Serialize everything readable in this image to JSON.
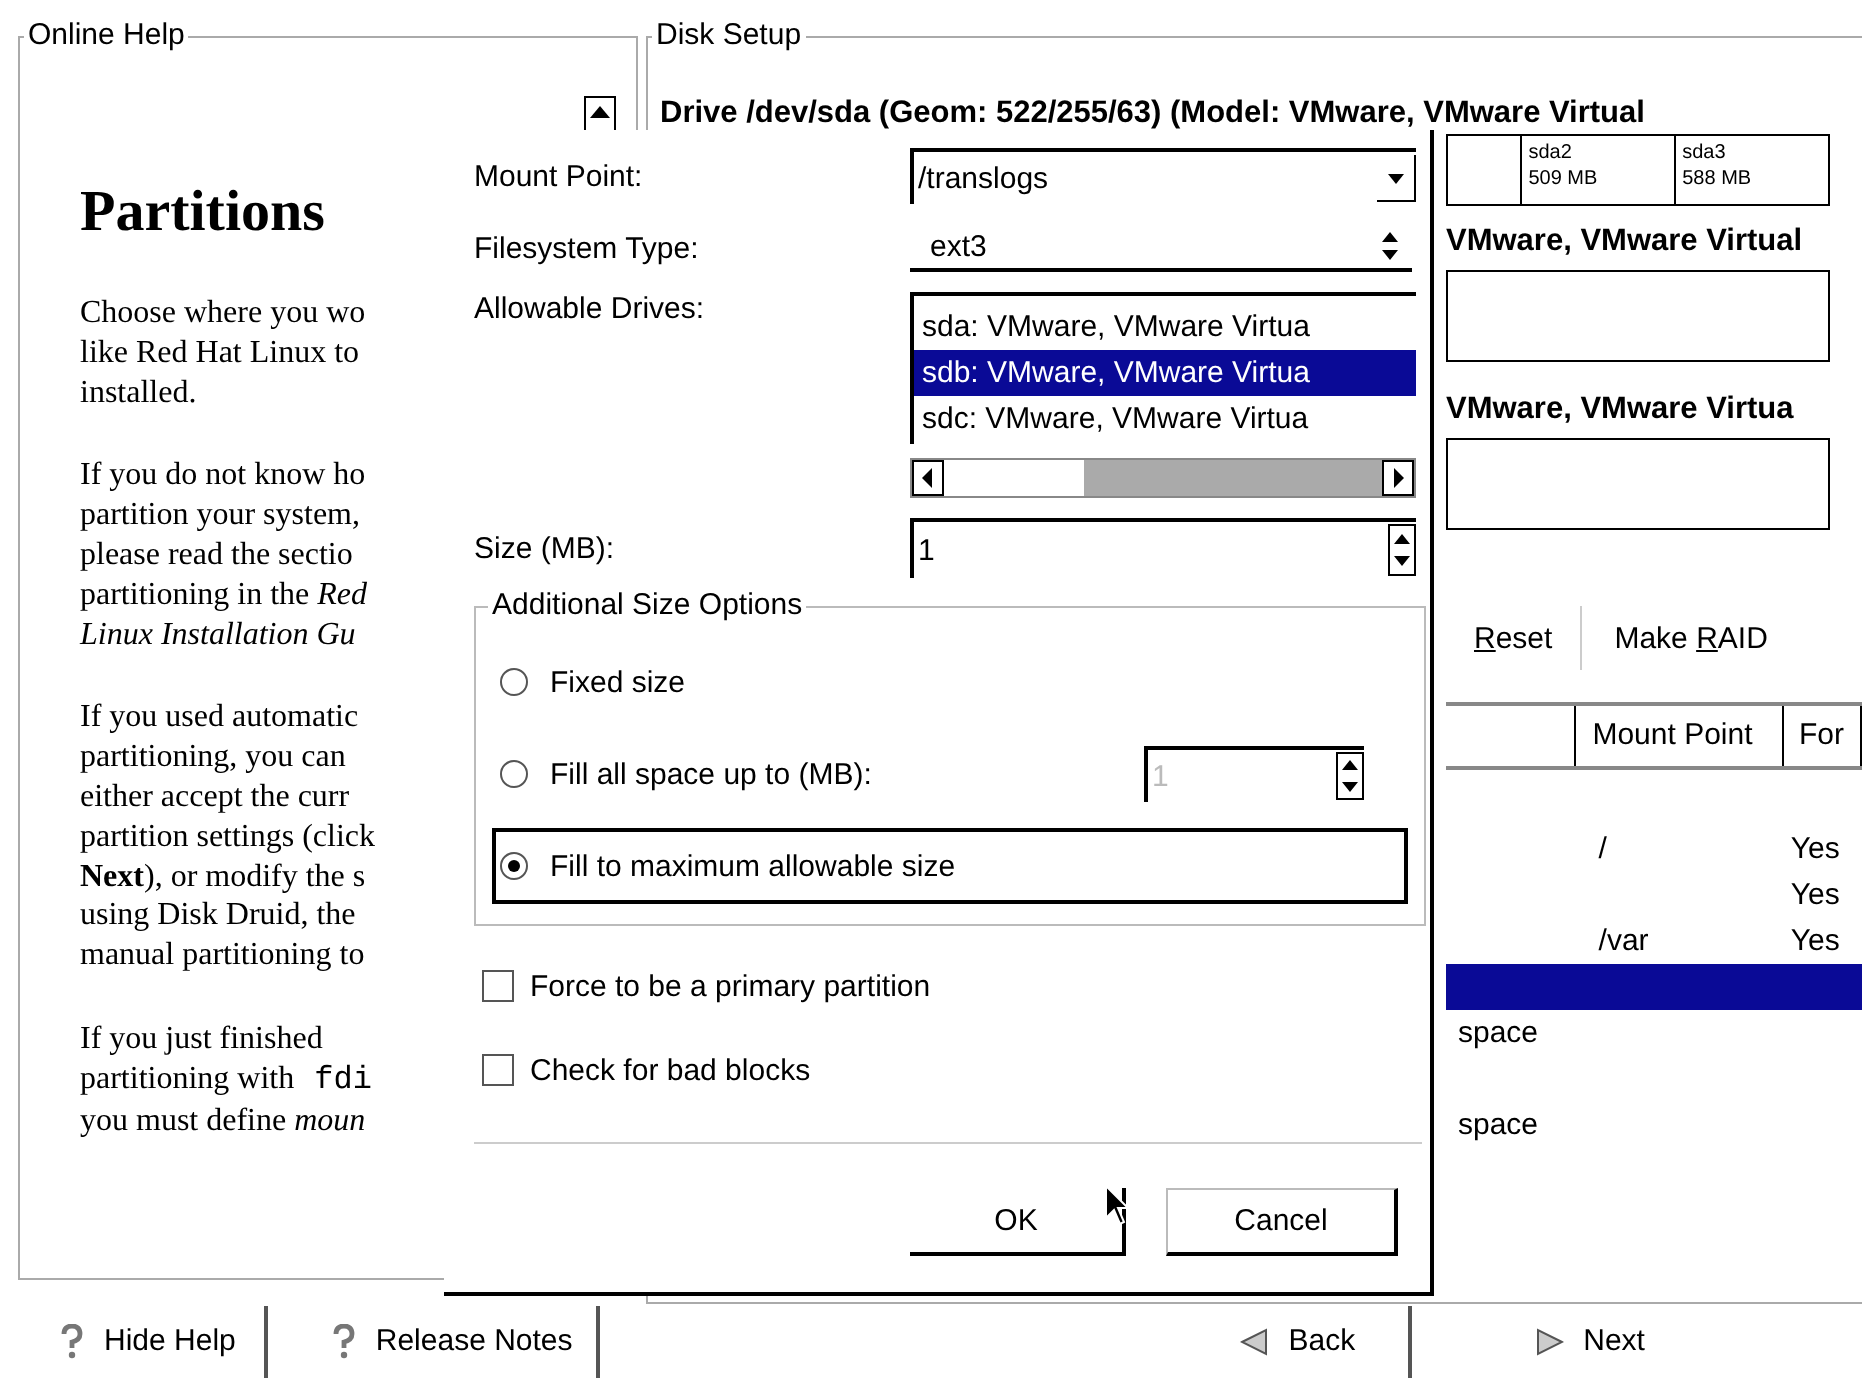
{
  "help_panel": {
    "title": "Online Help",
    "heading": "Partitions",
    "paragraphs": [
      [
        "Choose where you wo",
        "like Red Hat Linux to",
        "installed."
      ],
      [
        "If you do not know ho",
        "partition your system,",
        "please read the sectio",
        "partitioning in the *Red*",
        "*Linux Installation Gu*"
      ],
      [
        "If you used automatic",
        "partitioning, you can",
        "either accept the curr",
        "partition settings (click",
        "**Next**), or modify the s",
        "using Disk Druid, the",
        "manual partitioning to"
      ],
      [
        "If you just finished",
        {
          "text": "partitioning with",
          "code": "fdi"
        },
        "you must define *moun*"
      ]
    ]
  },
  "disk_setup": {
    "title": "Disk Setup",
    "drives": [
      {
        "heading": "Drive /dev/sda (Geom: 522/255/63) (Model: VMware, VMware Virtual",
        "partitions": [
          {
            "name": "sda2",
            "size": "509 MB"
          },
          {
            "name": "sda3",
            "size": "588 MB"
          }
        ]
      },
      {
        "heading": "VMware, VMware Virtual"
      },
      {
        "heading": "VMware, VMware Virtua"
      }
    ],
    "buttons": [
      {
        "mnemonic": "R",
        "rest": "eset"
      },
      {
        "prefix": "Make ",
        "mnemonic": "R",
        "rest": "AID"
      }
    ],
    "table": {
      "columns": [
        {
          "label": "Mount Point"
        },
        {
          "label": "For"
        }
      ],
      "rows": [
        {
          "mount_point": "/",
          "format": "Yes",
          "selected": false
        },
        {
          "format": "Yes",
          "selected": false
        },
        {
          "mount_point": "/var",
          "format": "Yes",
          "selected": false
        },
        {
          "selected": true
        },
        {
          "column_1": "space",
          "selected": false
        },
        {
          "selected": false
        },
        {
          "column_1": "space",
          "selected": false
        }
      ]
    }
  },
  "dialog": {
    "mount_point": {
      "label": "Mount Point:",
      "value": "/translogs"
    },
    "filesystem_type": {
      "label": "Filesystem Type:",
      "value": "ext3"
    },
    "allowable_drives": {
      "label": "Allowable Drives:",
      "items": [
        {
          "text": "sda: VMware, VMware Virtua",
          "selected": false
        },
        {
          "text": "sdb: VMware, VMware Virtua",
          "selected": true
        },
        {
          "text": "sdc: VMware, VMware Virtua",
          "selected": false
        }
      ]
    },
    "size": {
      "label": "Size (MB):",
      "value": "1"
    },
    "size_options": {
      "title": "Additional Size Options",
      "options": [
        {
          "label": "Fixed size",
          "selected": false,
          "focused": false
        },
        {
          "label": "Fill all space up to (MB):",
          "selected": false,
          "focused": false,
          "spin": {
            "value": "1",
            "disabled": true
          }
        },
        {
          "label": "Fill to maximum allowable size",
          "selected": true,
          "focused": true
        }
      ]
    },
    "checkboxes": [
      {
        "label": "Force to be a primary partition",
        "checked": false
      },
      {
        "label": "Check for bad blocks",
        "checked": false
      }
    ],
    "buttons": [
      {
        "label": "OK",
        "kind": "flat"
      },
      {
        "label": "Cancel",
        "kind": "raised"
      }
    ]
  },
  "bottom_bar": {
    "buttons": [
      {
        "label": "Hide Help",
        "kind": "help"
      },
      {
        "label": "Release Notes",
        "kind": "help"
      },
      {
        "label": "Back",
        "kind": "back"
      },
      {
        "label": "Next",
        "kind": "next"
      }
    ]
  }
}
